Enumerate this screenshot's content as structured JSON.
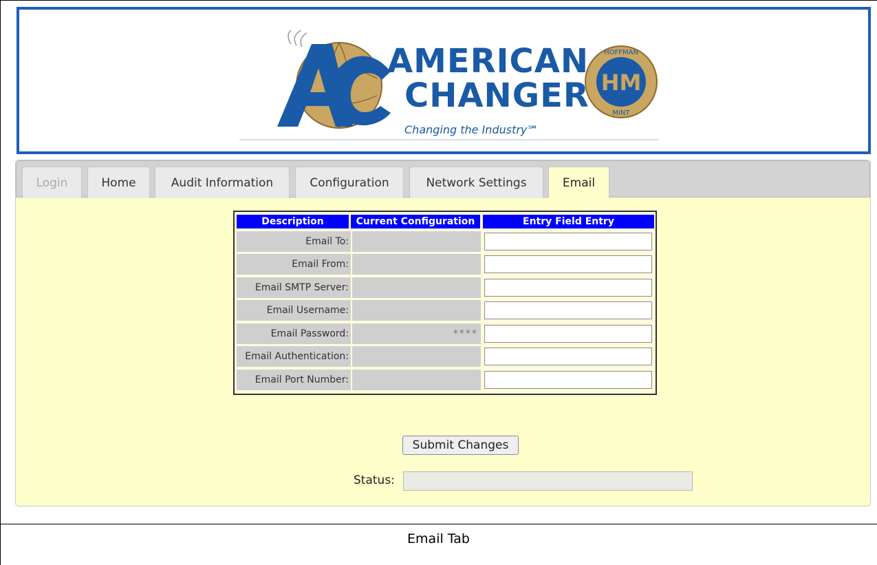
{
  "header": {
    "brand_line1": "AMERICAN",
    "brand_line2": "CHANGER",
    "tagline": "Changing the Industry℠",
    "logo_letters": "AC",
    "seal_letters": "HM",
    "seal_text": "HOFFMAN MINT"
  },
  "tabs": [
    {
      "label": "Login",
      "state": "disabled"
    },
    {
      "label": "Home",
      "state": "normal"
    },
    {
      "label": "Audit Information",
      "state": "normal"
    },
    {
      "label": "Configuration",
      "state": "normal"
    },
    {
      "label": "Network Settings",
      "state": "normal"
    },
    {
      "label": "Email",
      "state": "active"
    }
  ],
  "table": {
    "headers": [
      "Description",
      "Current Configuration",
      "Entry Field Entry"
    ],
    "rows": [
      {
        "description": "Email To:",
        "current": "",
        "entry": ""
      },
      {
        "description": "Email From:",
        "current": "",
        "entry": ""
      },
      {
        "description": "Email SMTP Server:",
        "current": "",
        "entry": ""
      },
      {
        "description": "Email Username:",
        "current": "",
        "entry": ""
      },
      {
        "description": "Email Password:",
        "current": "****",
        "entry": ""
      },
      {
        "description": "Email Authentication:",
        "current": "",
        "entry": ""
      },
      {
        "description": "Email Port Number:",
        "current": "",
        "entry": ""
      }
    ]
  },
  "submit_label": "Submit Changes",
  "status_label": "Status:",
  "status_value": "",
  "caption": "Email Tab",
  "colors": {
    "header_border": "#1f5dbb",
    "brand": "#1a5aa6",
    "panel_bg": "#ffffcc",
    "table_header": "#0000ff"
  }
}
